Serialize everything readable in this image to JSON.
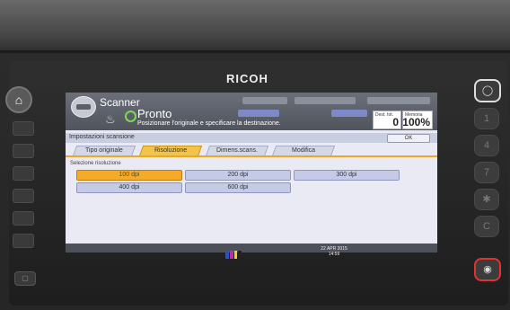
{
  "device": {
    "brand": "RICOH"
  },
  "header": {
    "app_title": "Scanner",
    "status": "Pronto",
    "instruction": "Posizionare l'originale e specificare la destinazione.",
    "dest_label": "Dest. tot.",
    "dest_count": "0",
    "memory_label": "Memoria",
    "memory_value": "100%"
  },
  "settings": {
    "title": "Impostazioni scansione",
    "ok_label": "OK"
  },
  "tabs": [
    {
      "label": "Tipo originale",
      "active": false
    },
    {
      "label": "Risoluzione",
      "active": true
    },
    {
      "label": "Dimens.scans.",
      "active": false
    },
    {
      "label": "Modifica",
      "active": false
    }
  ],
  "resolution": {
    "group_label": "Selezione risoluzione",
    "options": [
      {
        "label": "100 dpi",
        "selected": true
      },
      {
        "label": "200 dpi",
        "selected": false
      },
      {
        "label": "300 dpi",
        "selected": false
      },
      {
        "label": "400 dpi",
        "selected": false
      },
      {
        "label": "600 dpi",
        "selected": false
      }
    ]
  },
  "footer": {
    "date": "22 APR 2015",
    "time": "14:59"
  },
  "keys": {
    "right": [
      "1",
      "4",
      "7",
      "✱",
      "C"
    ],
    "home_icon": "home-icon",
    "stop_icon": "energy-saver-icon"
  },
  "colors": {
    "accent": "#f5ab27",
    "tab_active": "#f3c44b",
    "ready_green": "#7ed957",
    "header": "#5d616b",
    "stop_key_ring": "#d33333"
  },
  "toner_colors": [
    "#1f57c4",
    "#c52ca0",
    "#f1d41d",
    "#222222"
  ]
}
